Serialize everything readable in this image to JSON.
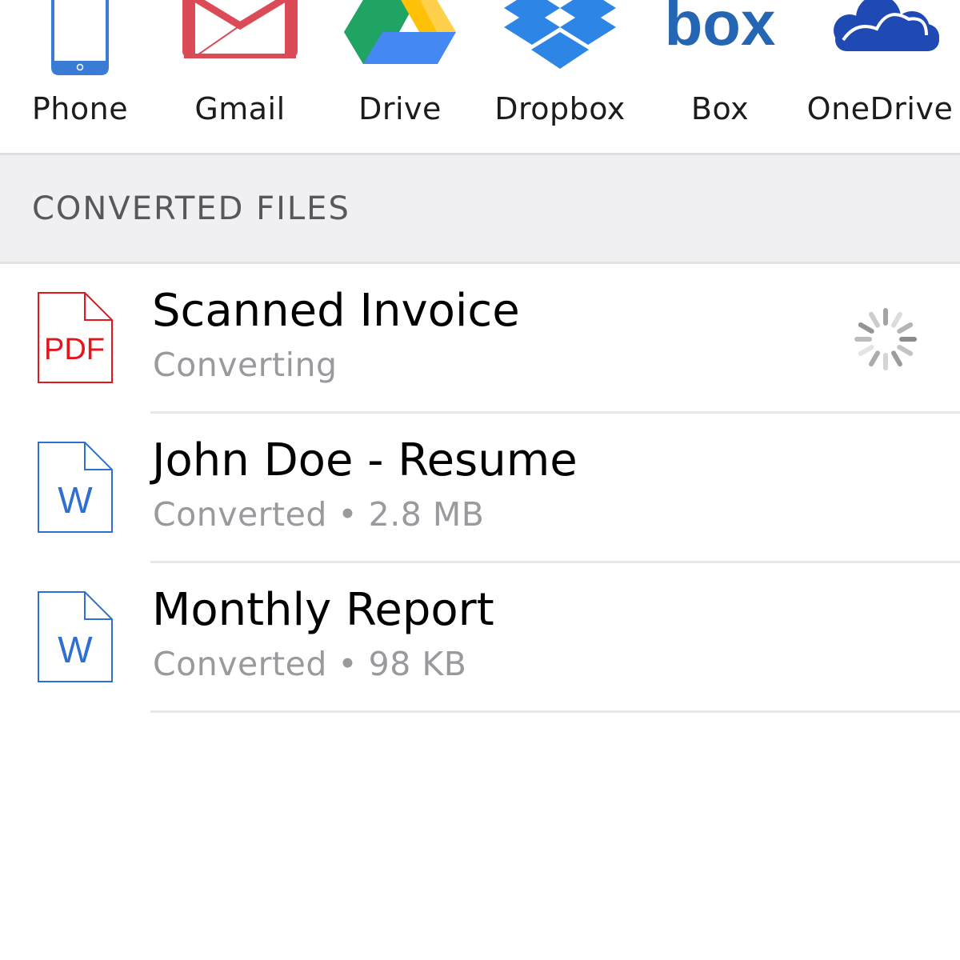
{
  "sources": [
    {
      "label": "Phone",
      "icon": "phone-icon"
    },
    {
      "label": "Gmail",
      "icon": "gmail-icon"
    },
    {
      "label": "Drive",
      "icon": "google-drive-icon"
    },
    {
      "label": "Dropbox",
      "icon": "dropbox-icon"
    },
    {
      "label": "Box",
      "icon": "box-icon"
    },
    {
      "label": "OneDrive",
      "icon": "onedrive-icon"
    }
  ],
  "box_logo_text": "box",
  "section_title": "CONVERTED FILES",
  "files": [
    {
      "name": "Scanned Invoice",
      "status": "Converting",
      "icon": "pdf-file-icon",
      "icon_text": "PDF",
      "loading": true
    },
    {
      "name": "John Doe - Resume",
      "status": "Converted • 2.8 MB",
      "icon": "word-file-icon",
      "icon_text": "W"
    },
    {
      "name": "Monthly Report",
      "status": "Converted • 98 KB",
      "icon": "word-file-icon",
      "icon_text": "W"
    }
  ],
  "colors": {
    "phone": "#3a7bd5",
    "gmail": "#db4a57",
    "drive_green": "#1fa463",
    "drive_yellow": "#ffd04b",
    "drive_blue": "#4688f1",
    "dropbox": "#2d86e5",
    "box": "#2466b3",
    "onedrive": "#1f4ab3",
    "pdf": "#e3161c",
    "word": "#2f6fd1"
  }
}
